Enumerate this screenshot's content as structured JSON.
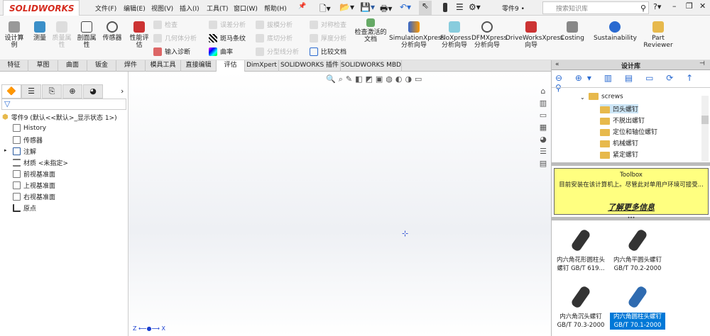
{
  "app": {
    "logo": "SOLIDWORKS",
    "document": "零件9 •",
    "search_placeholder": "搜索知识库"
  },
  "menu": [
    "文件(F)",
    "编辑(E)",
    "视图(V)",
    "插入(I)",
    "工具(T)",
    "窗口(W)",
    "帮助(H)"
  ],
  "ribbon": {
    "design_study": "设计算例",
    "measure": "测量",
    "mass_props": "质量属性",
    "section_props": "剖面属性",
    "sensor": "传感器",
    "perf_eval": "性能评估",
    "check": "检查",
    "geometry_analysis": "几何体分析",
    "import_diag": "输入诊断",
    "deviation": "误差分析",
    "zebra": "斑马条纹",
    "curvature": "曲率",
    "draft": "拔模分析",
    "undercut": "底切分析",
    "parting_line": "分型线分析",
    "symmetry": "对称检查",
    "thickness": "厚度分析",
    "compare": "比较文档",
    "check_active": "检查激活的文档",
    "simxpress": "SimulationXpress 分析向导",
    "floxpress": "FloXpress 分析向导",
    "dfmxpress": "DFMXpress 分析向导",
    "driveworks": "DriveWorksXpress 向导",
    "costing": "Costing",
    "sustainability": "Sustainability",
    "part_reviewer": "Part Reviewer"
  },
  "tabs": [
    "特征",
    "草图",
    "曲面",
    "钣金",
    "焊件",
    "模具工具",
    "直接编辑",
    "评估",
    "DimXpert",
    "SOLIDWORKS 插件",
    "SOLIDWORKS MBD"
  ],
  "tree": {
    "root": "零件9 (默认<<默认>_显示状态 1>)",
    "items": [
      "History",
      "传感器",
      "注解",
      "材质 <未指定>",
      "前视基准面",
      "上视基准面",
      "右视基准面",
      "原点"
    ]
  },
  "library": {
    "title": "设计库",
    "folder": "screws",
    "items": [
      "凹头螺钉",
      "不脱出螺钉",
      "定位和轴位螺钉",
      "机械螺钉",
      "紧定螺钉"
    ],
    "toolbox_title": "Toolbox",
    "toolbox_msg": "目前安装在该计算机上。尽管此对单用户环境可接受...",
    "learn_more": "了解更多信息",
    "parts": [
      {
        "l1": "内六角花形圆柱头",
        "l2": "螺钉 GB/T 619..."
      },
      {
        "l1": "内六角平圆头螺钉",
        "l2": "GB/T 70.2-2000"
      },
      {
        "l1": "内六角沉头螺钉",
        "l2": "GB/T 70.3-2000"
      },
      {
        "l1": "内六角圆柱头螺钉",
        "l2": "GB/T 70.1-2000"
      }
    ]
  },
  "colors": {
    "accent": "#0078d7",
    "toolbox_bg": "#ffff80",
    "brand": "#d52b1e"
  }
}
